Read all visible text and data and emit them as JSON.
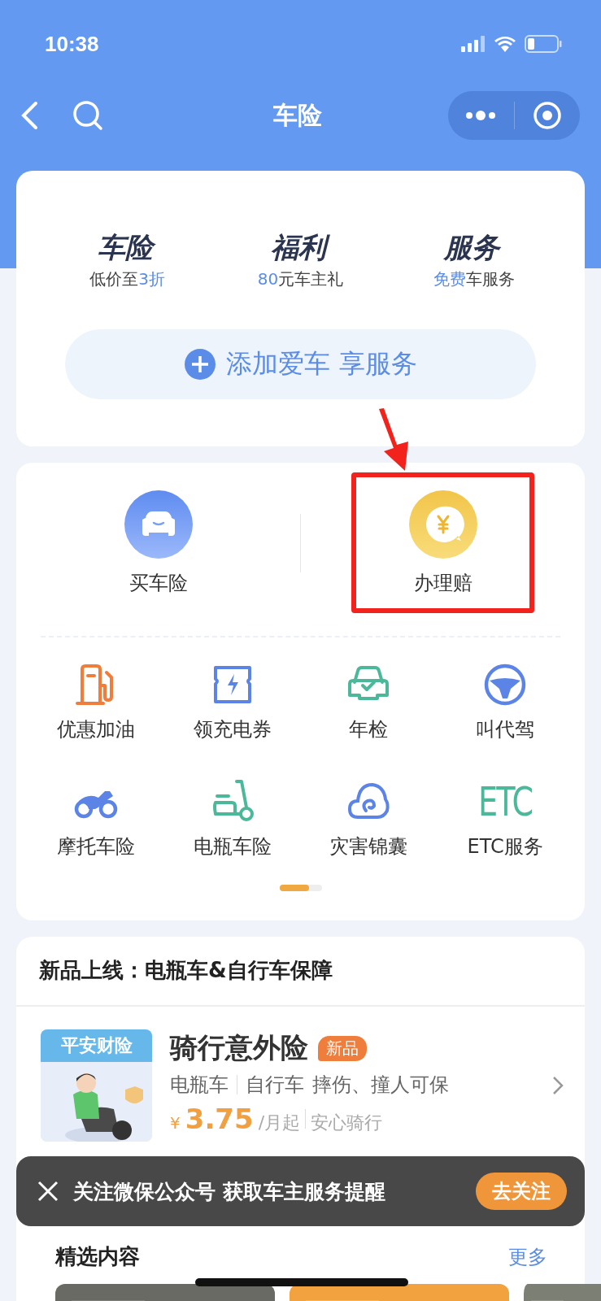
{
  "status_bar": {
    "time": "10:38"
  },
  "nav": {
    "title": "车险"
  },
  "promo": {
    "columns": [
      {
        "title": "车险",
        "subtitle": [
          {
            "text": "低价至",
            "accent": false
          },
          {
            "text": "3折",
            "accent": true
          }
        ]
      },
      {
        "title": "福利",
        "subtitle": [
          {
            "text": "80",
            "accent": true
          },
          {
            "text": "元车主礼",
            "accent": false
          }
        ]
      },
      {
        "title": "服务",
        "subtitle": [
          {
            "text": "免费",
            "accent": true
          },
          {
            "text": "车服务",
            "accent": false
          }
        ]
      }
    ],
    "add_button": "添加爱车 享服务"
  },
  "main_actions": [
    {
      "label": "买车险",
      "kind": "car",
      "highlighted": false
    },
    {
      "label": "办理赔",
      "kind": "coin",
      "highlighted": true
    }
  ],
  "services": [
    {
      "label": "优惠加油",
      "kind": "fuel"
    },
    {
      "label": "领充电券",
      "kind": "charge"
    },
    {
      "label": "年检",
      "kind": "inspection"
    },
    {
      "label": "叫代驾",
      "kind": "wheel"
    },
    {
      "label": "摩托车险",
      "kind": "motorcycle"
    },
    {
      "label": "电瓶车险",
      "kind": "scooter"
    },
    {
      "label": "灾害锦囊",
      "kind": "cloud"
    },
    {
      "label": "ETC服务",
      "kind": "etc",
      "icon_text": "ETC"
    }
  ],
  "section": {
    "title": "新品上线：电瓶车&自行车保障",
    "product": {
      "brand": "平安财险",
      "name": "骑行意外险",
      "badge": "新品",
      "categories": [
        "电瓶车",
        "自行车"
      ],
      "feature": "摔伤、撞人可保",
      "currency": "¥",
      "price": "3.75",
      "unit": "/月起",
      "slogan": "安心骑行"
    }
  },
  "featured": {
    "title": "精选内容",
    "more": "更多"
  },
  "toast": {
    "text": "关注微保公众号 获取车主服务提醒",
    "button": "去关注"
  }
}
